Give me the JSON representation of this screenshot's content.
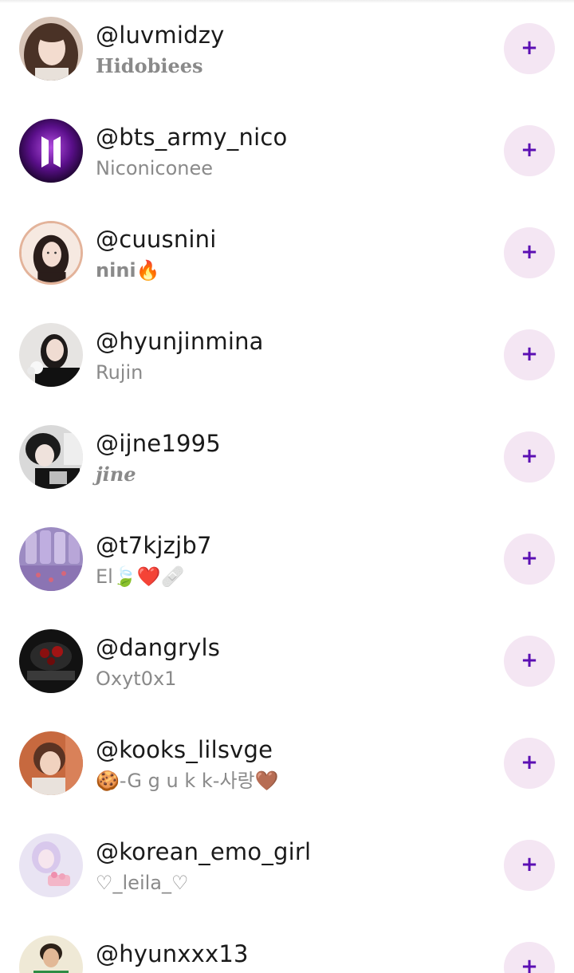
{
  "accent_color": "#5b0fb3",
  "button_bg": "#f4e6f3",
  "add_icon": "+",
  "users": [
    {
      "handle": "@luvmidzy",
      "display_name": "Hidobiees",
      "avatar": "portrait-girl-avatar"
    },
    {
      "handle": "@bts_army_nico",
      "display_name": "Niconiconee",
      "avatar": "bts-logo-avatar"
    },
    {
      "handle": "@cuusnini",
      "display_name": "nini🔥",
      "avatar": "illustrated-girl-avatar"
    },
    {
      "handle": "@hyunjinmina",
      "display_name": "Rujin",
      "avatar": "girl-with-flowers-avatar"
    },
    {
      "handle": "@ijne1995",
      "display_name": "jine",
      "avatar": "girl-selfie-avatar"
    },
    {
      "handle": "@t7kjzjb7",
      "display_name": "El🍃❤️🩹",
      "avatar": "purple-bottles-avatar"
    },
    {
      "handle": "@dangryls",
      "display_name": "Oxyt0x1",
      "avatar": "dark-red-avatar"
    },
    {
      "handle": "@kooks_lilsvge",
      "display_name": "🍪-G g u k k-사랑🤎",
      "avatar": "boy-portrait-avatar"
    },
    {
      "handle": "@korean_emo_girl",
      "display_name": "♡_leila_♡",
      "avatar": "pastel-pink-avatar"
    },
    {
      "handle": "@hyunxxx13",
      "display_name": "",
      "avatar": "boy-green-shirt-avatar"
    }
  ]
}
